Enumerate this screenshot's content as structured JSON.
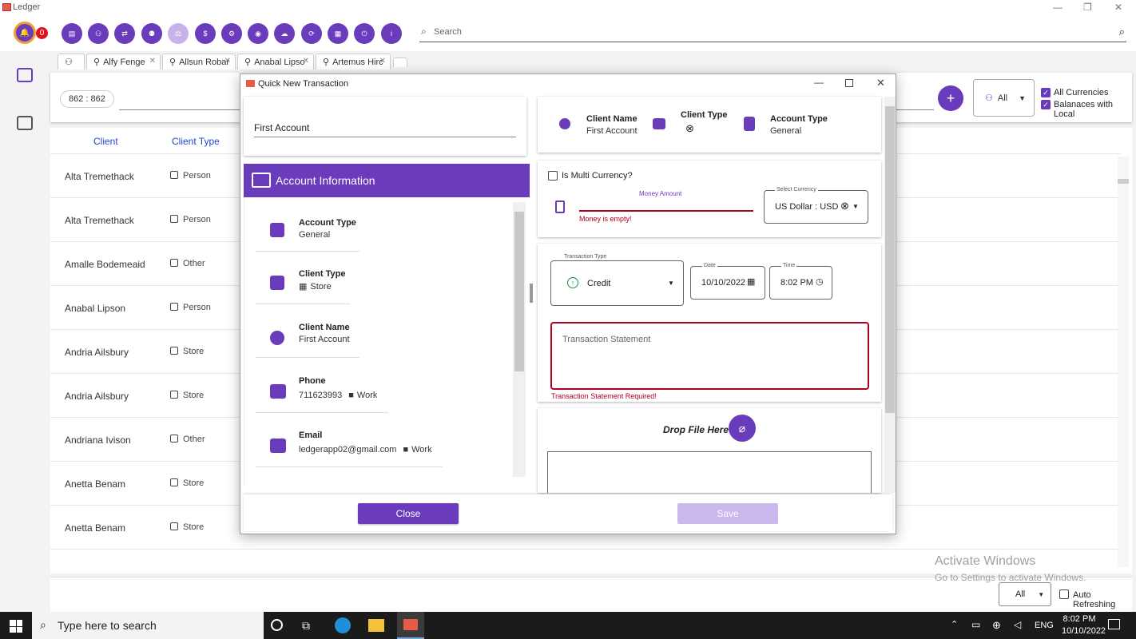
{
  "window": {
    "title": "Ledger",
    "min": "—",
    "max": "❐",
    "close": "✕"
  },
  "toolbar": {
    "notification_count": "0",
    "search_placeholder": "Search",
    "buttons": [
      "doc",
      "group",
      "exchange",
      "people",
      "balance",
      "currency",
      "settings",
      "lock",
      "cloud",
      "sync",
      "calculator",
      "power",
      "info"
    ]
  },
  "tabs": [
    {
      "label": "Alfy Fenge"
    },
    {
      "label": "Allsun Robar"
    },
    {
      "label": "Anabal Lipso"
    },
    {
      "label": "Artemus Hirc"
    }
  ],
  "main": {
    "counter": "862 : 862",
    "filter_value": "All",
    "checks": [
      {
        "label": "All Currencies",
        "checked": true
      },
      {
        "label": "Balanaces with Local",
        "checked": true
      }
    ],
    "columns": {
      "client": "Client",
      "client_type": "Client Type"
    },
    "rows": [
      {
        "name": "Alta Tremethack",
        "type": "Person"
      },
      {
        "name": "Alta Tremethack",
        "type": "Person"
      },
      {
        "name": "Amalle Bodemeaid",
        "type": "Other"
      },
      {
        "name": "Anabal Lipson",
        "type": "Person"
      },
      {
        "name": "Andria Ailsbury",
        "type": "Store"
      },
      {
        "name": "Andria Ailsbury",
        "type": "Store"
      },
      {
        "name": "Andriana Ivison",
        "type": "Other"
      },
      {
        "name": "Anetta Benam",
        "type": "Store"
      },
      {
        "name": "Anetta Benam",
        "type": "Store"
      }
    ]
  },
  "footer": {
    "page_size": "All",
    "auto_refresh": "Auto Refreshing"
  },
  "watermark": {
    "line1": "Activate Windows",
    "line2": "Go to Settings to activate Windows."
  },
  "dialog": {
    "title": "Quick New Transaction",
    "account_field": "First Account",
    "section_title": "Account Information",
    "info": [
      {
        "label": "Account Type",
        "value": "General",
        "icon": "account-type-icon"
      },
      {
        "label": "Client Type",
        "value": "Store",
        "icon": "client-type-icon"
      },
      {
        "label": "Client Name",
        "value": "First Account",
        "icon": "person-icon"
      },
      {
        "label": "Phone",
        "value": "711623993",
        "tag": "Work",
        "icon": "phone-icon"
      },
      {
        "label": "Email",
        "value": "ledgerapp02@gmail.com",
        "tag": "Work",
        "icon": "email-icon"
      }
    ],
    "summary": {
      "client_name_label": "Client Name",
      "client_name": "First Account",
      "client_type_label": "Client Type",
      "account_type_label": "Account Type",
      "account_type": "General"
    },
    "multi_currency_label": "Is Multi Currency?",
    "money_label": "Money Amount",
    "money_error": "Money is empty!",
    "currency_label": "Select Currency",
    "currency_value": "US Dollar : USD",
    "txn_type_label": "Transaction Type",
    "txn_type": "Credit",
    "date_label": "Date",
    "date": "10/10/2022",
    "time_label": "Time",
    "time": "8:02 PM",
    "statement_placeholder": "Transaction Statement",
    "statement_error": "Transaction Statement Required!",
    "drop_label": "Drop File Here",
    "close_label": "Close",
    "save_label": "Save"
  },
  "taskbar": {
    "search": "Type here to search",
    "lang": "ENG",
    "time": "8:02 PM",
    "date": "10/10/2022"
  },
  "colors": {
    "accent": "#6a3cbc",
    "error": "#b00020"
  }
}
